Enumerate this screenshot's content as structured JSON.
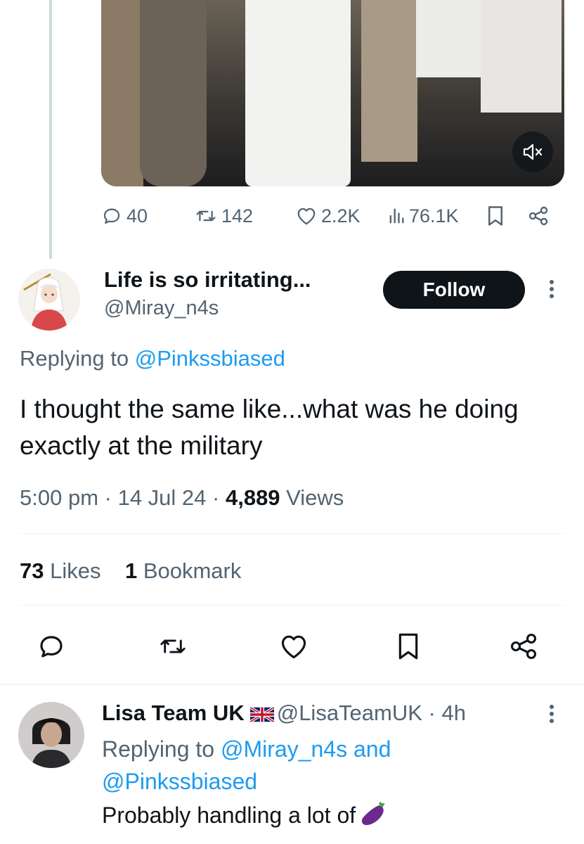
{
  "stats": {
    "replies": "40",
    "reposts": "142",
    "likes": "2.2K",
    "views": "76.1K"
  },
  "tweet": {
    "display_name": "Life is so irritating...",
    "handle": "@Miray_n4s",
    "follow_label": "Follow",
    "replying_prefix": "Replying to ",
    "replying_handle": "@Pinkssbiased",
    "text": "I thought the same like...what was he doing exactly at the military",
    "time": "5:00 pm",
    "date": "14 Jul 24",
    "views_count": "4,889",
    "views_label": "Views",
    "likes_count": "73",
    "likes_label": "Likes",
    "bookmarks_count": "1",
    "bookmarks_label": "Bookmark"
  },
  "reply": {
    "display_name": "Lisa Team UK",
    "handle": "@LisaTeamUK",
    "age": "4h",
    "replying_prefix": "Replying to ",
    "replying_handle_1": "@Miray_n4s",
    "replying_and": " and ",
    "replying_handle_2": "@Pinkssbiased",
    "text": "Probably handling a lot of"
  },
  "icons": {
    "reply": "reply-icon",
    "repost": "repost-icon",
    "like": "heart-icon",
    "views": "views-icon",
    "bookmark": "bookmark-icon",
    "share": "share-icon",
    "mute": "mute-icon",
    "more": "more-vertical-icon",
    "flag": "uk-flag-icon",
    "emoji": "eggplant-emoji"
  },
  "colors": {
    "text": "#0f1419",
    "secondary": "#536471",
    "link": "#1d9bf0",
    "button": "#0f1419",
    "divider": "#eff3f4"
  }
}
